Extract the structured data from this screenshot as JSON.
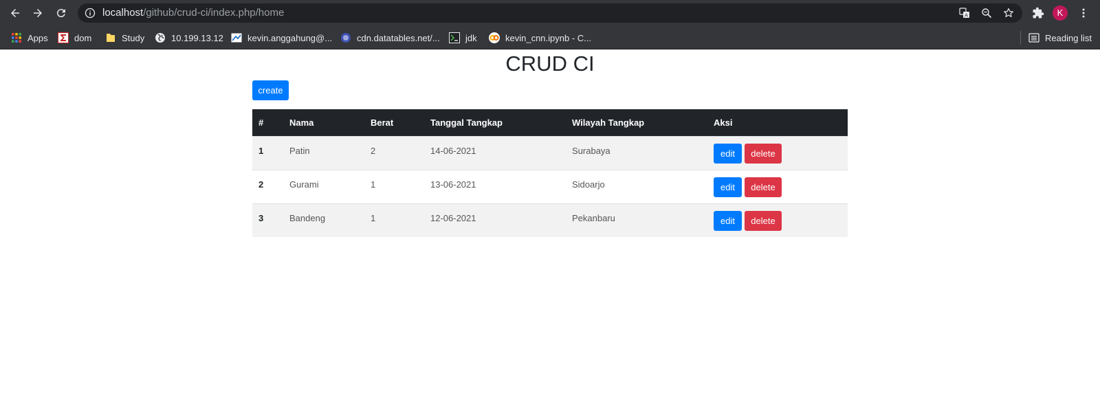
{
  "browser": {
    "url_host": "localhost",
    "url_path": "/github/crud-ci/index.php/home",
    "profile_initial": "K",
    "reading_list_label": "Reading list",
    "bookmarks": [
      {
        "label": "Apps",
        "icon": "apps-grid-icon"
      },
      {
        "label": "dom",
        "icon": "sigma-icon"
      },
      {
        "label": "Study",
        "icon": "folder-icon"
      },
      {
        "label": "10.199.13.12",
        "icon": "globe-icon"
      },
      {
        "label": "kevin.anggahung@...",
        "icon": "mail-icon"
      },
      {
        "label": "cdn.datatables.net/...",
        "icon": "datatables-icon"
      },
      {
        "label": "jdk",
        "icon": "terminal-icon"
      },
      {
        "label": "kevin_cnn.ipynb - C...",
        "icon": "colab-icon"
      }
    ]
  },
  "page": {
    "title": "CRUD CI",
    "create_label": "create"
  },
  "table": {
    "columns": [
      "#",
      "Nama",
      "Berat",
      "Tanggal Tangkap",
      "Wilayah Tangkap",
      "Aksi"
    ],
    "rows": [
      {
        "no": "1",
        "nama": "Patin",
        "berat": "2",
        "tanggal": "14-06-2021",
        "wilayah": "Surabaya"
      },
      {
        "no": "2",
        "nama": "Gurami",
        "berat": "1",
        "tanggal": "13-06-2021",
        "wilayah": "Sidoarjo"
      },
      {
        "no": "3",
        "nama": "Bandeng",
        "berat": "1",
        "tanggal": "12-06-2021",
        "wilayah": "Pekanbaru"
      }
    ],
    "edit_label": "edit",
    "delete_label": "delete"
  },
  "colors": {
    "primary": "#007bff",
    "danger": "#dc3545",
    "table_header": "#212529",
    "chrome_bg": "#35363a"
  }
}
